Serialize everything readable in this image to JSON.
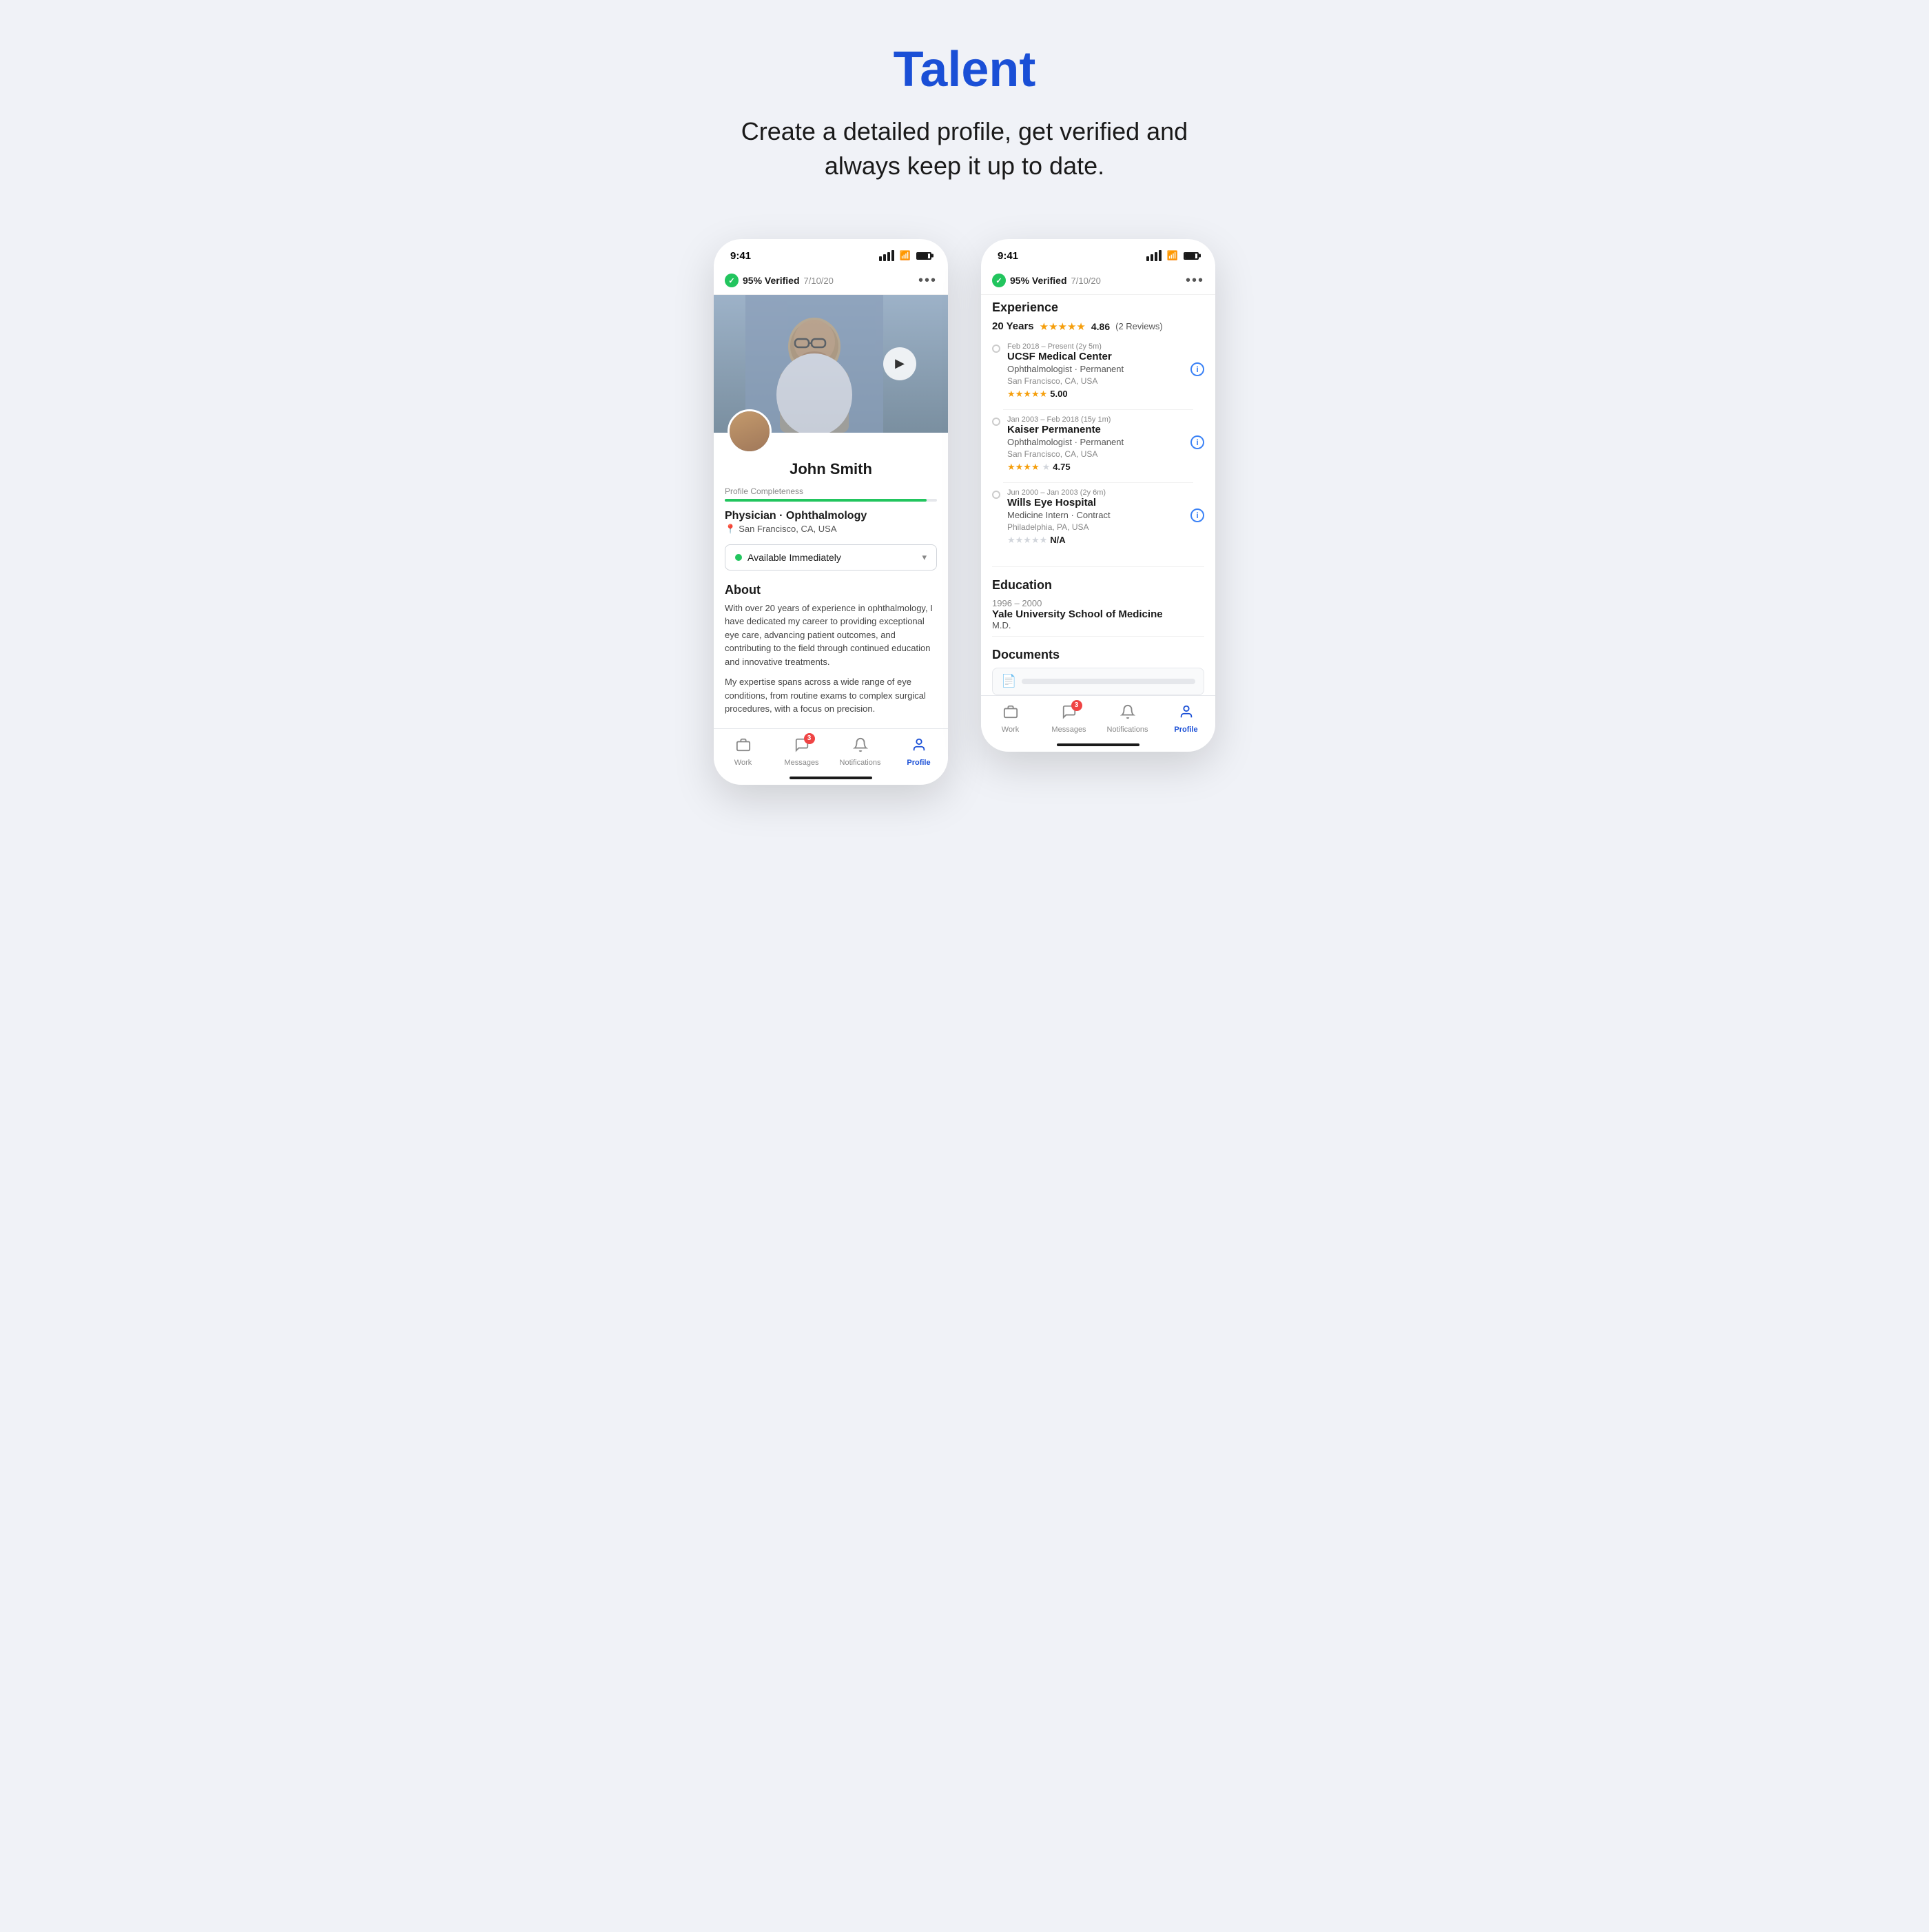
{
  "page": {
    "background_color": "#f0f2f7",
    "title": "Talent",
    "subtitle": "Create a detailed profile, get verified and always keep it up to date."
  },
  "phone1": {
    "status_bar": {
      "time": "9:41"
    },
    "verified": {
      "percent": "95% Verified",
      "date": "7/10/20"
    },
    "user": {
      "name": "John Smith",
      "completeness_label": "Profile Completeness",
      "specialty": "Physician · Ophthalmology",
      "location": "San Francisco, CA, USA",
      "availability": "Available Immediately"
    },
    "about": {
      "title": "About",
      "para1": "With over 20 years of experience in ophthalmology, I have dedicated my career to providing exceptional eye care, advancing patient outcomes, and contributing to the field through continued education and innovative treatments.",
      "para2": "My expertise spans across a wide range of eye conditions, from routine exams to complex surgical procedures, with a focus on precision."
    },
    "nav": {
      "work_label": "Work",
      "messages_label": "Messages",
      "messages_badge": "3",
      "notifications_label": "Notifications",
      "profile_label": "Profile",
      "active_tab": "profile"
    }
  },
  "phone2": {
    "status_bar": {
      "time": "9:41"
    },
    "verified": {
      "percent": "95% Verified",
      "date": "7/10/20"
    },
    "experience": {
      "section_title": "Experience",
      "years": "20 Years",
      "rating": "4.86",
      "reviews": "(2 Reviews)",
      "items": [
        {
          "date": "Feb 2018 – Present (2y 5m)",
          "org": "UCSF Medical Center",
          "role": "Ophthalmologist",
          "type": "Permanent",
          "location": "San Francisco, CA, USA",
          "stars": 5,
          "score": "5.00"
        },
        {
          "date": "Jan 2003 – Feb 2018 (15y 1m)",
          "org": "Kaiser Permanente",
          "role": "Ophthalmologist",
          "type": "Permanent",
          "location": "San Francisco, CA, USA",
          "stars": 4,
          "score": "4.75"
        },
        {
          "date": "Jun 2000 – Jan 2003 (2y 6m)",
          "org": "Wills Eye Hospital",
          "role": "Medicine Intern",
          "type": "Contract",
          "location": "Philadelphia, PA, USA",
          "stars": 0,
          "score": "N/A"
        }
      ]
    },
    "education": {
      "section_title": "Education",
      "years": "1996 – 2000",
      "school": "Yale University School of Medicine",
      "degree": "M.D."
    },
    "documents": {
      "section_title": "Documents"
    },
    "nav": {
      "work_label": "Work",
      "messages_label": "Messages",
      "messages_badge": "3",
      "notifications_label": "Notifications",
      "profile_label": "Profile",
      "active_tab": "profile"
    }
  }
}
